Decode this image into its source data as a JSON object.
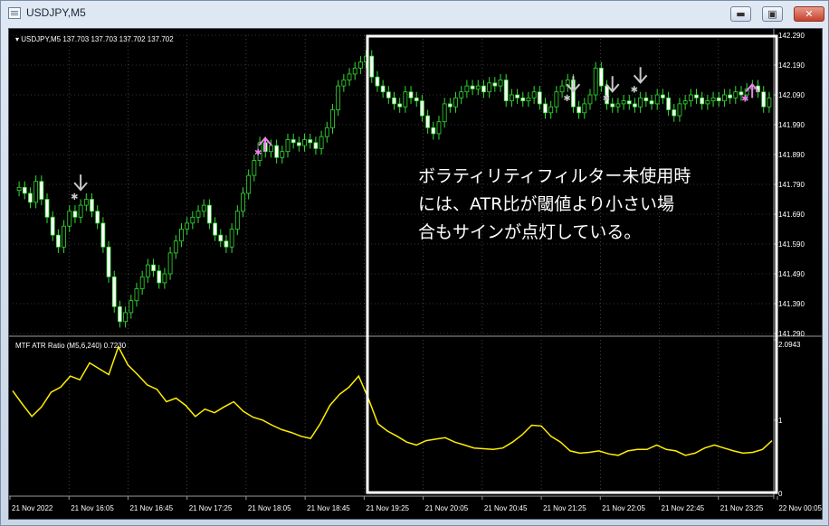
{
  "window": {
    "title": "USDJPY,M5",
    "minimize_label": "▬",
    "maximize_label": "▣",
    "close_label": "✕"
  },
  "main_panel": {
    "header": "USDJPY,M5  137.703 137.703 137.702 137.702",
    "price_axis": [
      "142.290",
      "142.190",
      "142.090",
      "141.990",
      "141.890",
      "141.790",
      "141.690",
      "141.590",
      "141.490",
      "141.390",
      "141.290"
    ]
  },
  "indicator_panel": {
    "header": "MTF ATR Ratio  (M5,6,240) 0.7230",
    "axis_labels": [
      "2.0943",
      "1",
      "0"
    ]
  },
  "time_axis": [
    "21 Nov 2022",
    "21 Nov 16:05",
    "21 Nov 16:45",
    "21 Nov 17:25",
    "21 Nov 18:05",
    "21 Nov 18:45",
    "21 Nov 19:25",
    "21 Nov 20:05",
    "21 Nov 20:45",
    "21 Nov 21:25",
    "21 Nov 22:05",
    "21 Nov 22:45",
    "21 Nov 23:25",
    "22 Nov 00:05"
  ],
  "annotation": {
    "lines": [
      "ボラティリティフィルター未使用時",
      "には、ATR比が閾値より小さい場",
      "合もサインが点灯している。"
    ]
  },
  "colors": {
    "candle": "#33dd33",
    "atr_line": "#ffee00",
    "sell_arrow": "#c8c8c8",
    "buy_arrow": "#ee82ee",
    "highlight_box": "#ffffff"
  },
  "chart_data": {
    "type": "candlestick",
    "symbol": "USDJPY",
    "timeframe": "M5",
    "ylim": [
      141.29,
      142.29
    ],
    "close_prices": [
      141.78,
      141.76,
      141.73,
      141.8,
      141.74,
      141.68,
      141.62,
      141.58,
      141.65,
      141.7,
      141.68,
      141.72,
      141.74,
      141.7,
      141.66,
      141.58,
      141.48,
      141.38,
      141.33,
      141.36,
      141.4,
      141.44,
      141.48,
      141.52,
      141.5,
      141.46,
      141.49,
      141.56,
      141.6,
      141.64,
      141.66,
      141.68,
      141.7,
      141.72,
      141.66,
      141.62,
      141.6,
      141.58,
      141.64,
      141.7,
      141.76,
      141.82,
      141.87,
      141.93,
      141.9,
      141.92,
      141.88,
      141.9,
      141.94,
      141.93,
      141.92,
      141.94,
      141.93,
      141.91,
      141.95,
      141.98,
      142.04,
      142.12,
      142.14,
      142.16,
      142.18,
      142.2,
      142.22,
      142.15,
      142.12,
      142.1,
      142.08,
      142.06,
      142.05,
      142.1,
      142.08,
      142.07,
      142.02,
      141.98,
      141.96,
      142.0,
      142.06,
      142.05,
      142.08,
      142.1,
      142.12,
      142.11,
      142.12,
      142.1,
      142.13,
      142.12,
      142.14,
      142.07,
      142.09,
      142.08,
      142.07,
      142.08,
      142.1,
      142.06,
      142.03,
      142.05,
      142.1,
      142.12,
      142.14,
      142.05,
      142.03,
      142.06,
      142.09,
      142.18,
      142.12,
      142.06,
      142.05,
      142.06,
      142.07,
      142.06,
      142.05,
      142.08,
      142.07,
      142.06,
      142.09,
      142.08,
      142.04,
      142.02,
      142.06,
      142.07,
      142.09,
      142.08,
      142.06,
      142.07,
      142.08,
      142.07,
      142.09,
      142.08,
      142.1,
      142.09,
      142.11,
      142.12,
      142.1,
      142.05,
      142.08
    ],
    "atr_ratio": {
      "ylim": [
        0,
        2.0943
      ],
      "threshold": 1,
      "values": [
        1.4,
        1.22,
        1.05,
        1.18,
        1.38,
        1.45,
        1.6,
        1.55,
        1.78,
        1.7,
        1.62,
        2.0,
        1.75,
        1.62,
        1.48,
        1.42,
        1.25,
        1.3,
        1.2,
        1.05,
        1.15,
        1.1,
        1.18,
        1.25,
        1.12,
        1.04,
        1.0,
        0.93,
        0.87,
        0.83,
        0.78,
        0.75,
        0.95,
        1.2,
        1.35,
        1.45,
        1.6,
        1.3,
        0.95,
        0.85,
        0.78,
        0.7,
        0.66,
        0.72,
        0.74,
        0.76,
        0.7,
        0.66,
        0.62,
        0.61,
        0.6,
        0.62,
        0.7,
        0.8,
        0.93,
        0.92,
        0.78,
        0.7,
        0.58,
        0.55,
        0.56,
        0.58,
        0.54,
        0.52,
        0.58,
        0.6,
        0.6,
        0.66,
        0.6,
        0.58,
        0.52,
        0.55,
        0.62,
        0.66,
        0.62,
        0.58,
        0.55,
        0.56,
        0.6,
        0.72
      ]
    },
    "signals": {
      "sell_bars": [
        11,
        99,
        106,
        111
      ],
      "buy_bars": [
        43,
        130
      ]
    }
  }
}
